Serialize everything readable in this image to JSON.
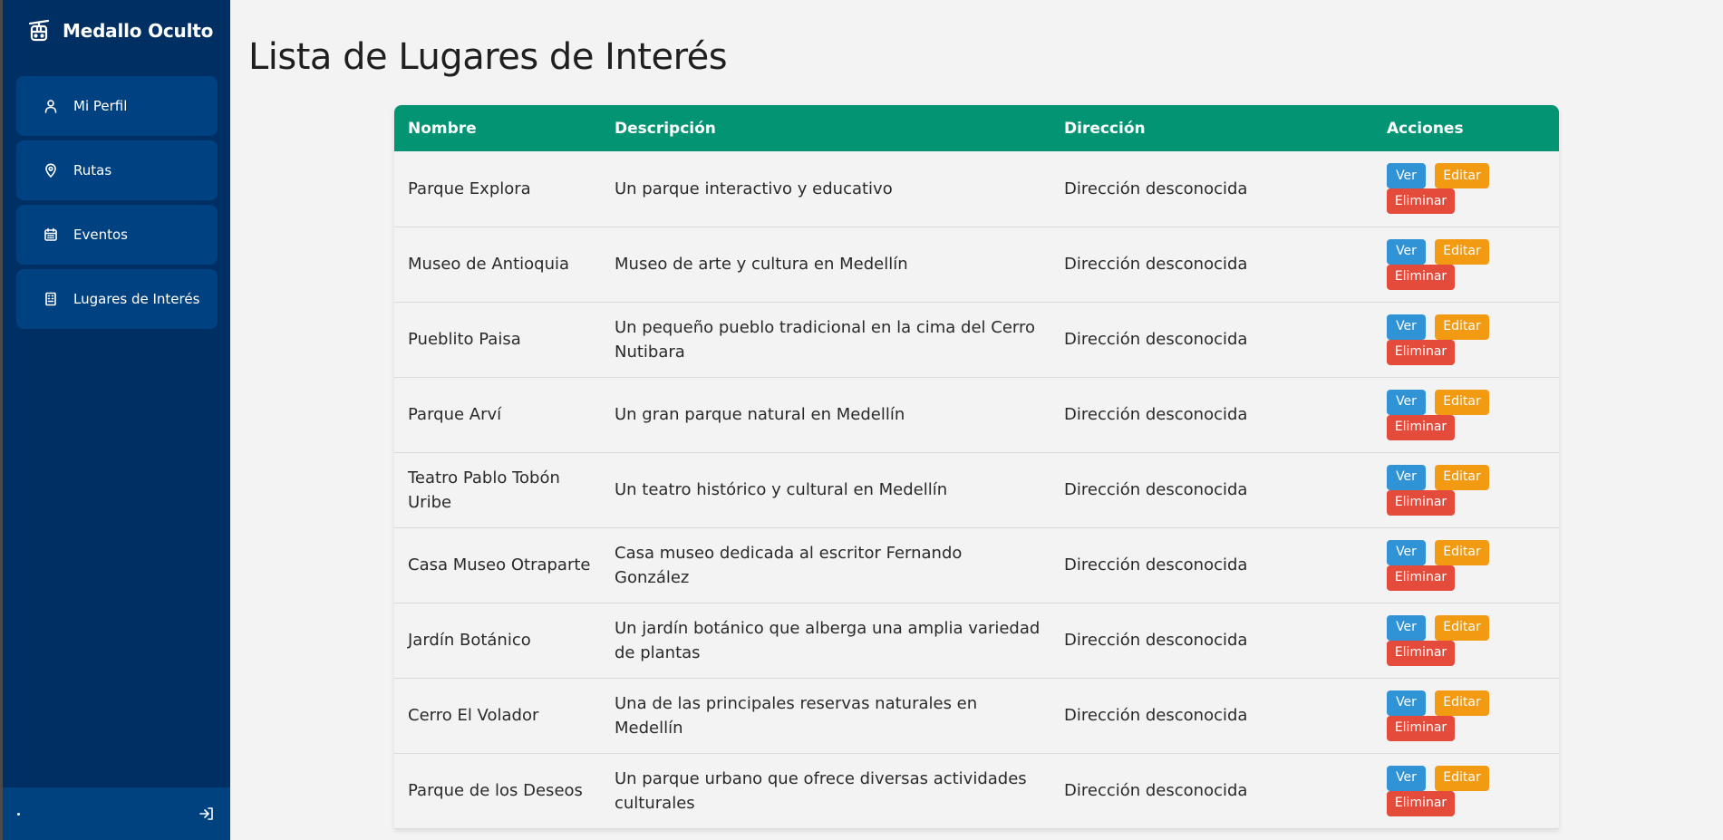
{
  "app": {
    "brand_title": "Medallo Oculto"
  },
  "sidebar": {
    "items": [
      {
        "label": "Mi Perfil",
        "icon": "user-icon"
      },
      {
        "label": "Rutas",
        "icon": "map-pin-icon"
      },
      {
        "label": "Eventos",
        "icon": "calendar-icon"
      },
      {
        "label": "Lugares de Interés",
        "icon": "building-icon"
      }
    ],
    "footer_icon": "logout-icon"
  },
  "main": {
    "title": "Lista de Lugares de Interés",
    "table": {
      "headers": [
        "Nombre",
        "Descripción",
        "Dirección",
        "Acciones"
      ],
      "actions": {
        "view": "Ver",
        "edit": "Editar",
        "delete": "Eliminar"
      },
      "rows": [
        {
          "name": "Parque Explora",
          "description": "Un parque interactivo y educativo",
          "address": "Dirección desconocida"
        },
        {
          "name": "Museo de Antioquia",
          "description": "Museo de arte y cultura en Medellín",
          "address": "Dirección desconocida"
        },
        {
          "name": "Pueblito Paisa",
          "description": "Un pequeño pueblo tradicional en la cima del Cerro Nutibara",
          "address": "Dirección desconocida"
        },
        {
          "name": "Parque Arví",
          "description": "Un gran parque natural en Medellín",
          "address": "Dirección desconocida"
        },
        {
          "name": "Teatro Pablo Tobón Uribe",
          "description": "Un teatro histórico y cultural en Medellín",
          "address": "Dirección desconocida"
        },
        {
          "name": "Casa Museo Otraparte",
          "description": "Casa museo dedicada al escritor Fernando González",
          "address": "Dirección desconocida"
        },
        {
          "name": "Jardín Botánico",
          "description": "Un jardín botánico que alberga una amplia variedad de plantas",
          "address": "Dirección desconocida"
        },
        {
          "name": "Cerro El Volador",
          "description": "Una de las principales reservas naturales en Medellín",
          "address": "Dirección desconocida"
        },
        {
          "name": "Parque de los Deseos",
          "description": "Un parque urbano que ofrece diversas actividades culturales",
          "address": "Dirección desconocida"
        }
      ]
    }
  },
  "colors": {
    "sidebar_bg": "#002f63",
    "nav_item_bg": "#004281",
    "table_header_bg": "#039474",
    "btn_view": "#2f93d6",
    "btn_edit": "#f29a12",
    "btn_delete": "#e54b3b"
  }
}
